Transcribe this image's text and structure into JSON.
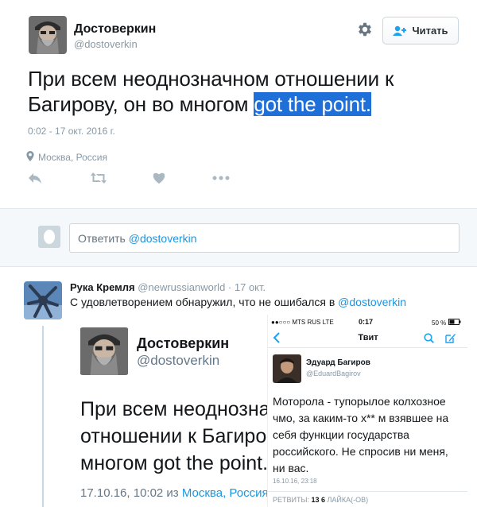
{
  "main_tweet": {
    "author_name": "Достоверкин",
    "author_handle": "@dostoverkin",
    "follow_label": "Читать",
    "text_plain": "При всем неоднозначном отношении к Багирову, он во многом ",
    "text_highlight": "got the point.",
    "time": "0:02 - 17 окт. 2016 г.",
    "location": "Москва, Россия",
    "actions": [
      "reply-icon",
      "retweet-icon",
      "like-icon",
      "more-icon"
    ]
  },
  "reply_box": {
    "prefix": "Ответить ",
    "mention": "@dostoverkin"
  },
  "second_tweet": {
    "author_name": "Рука Кремля",
    "author_handle": "@newrussianworld",
    "separator": " · ",
    "time": "17 окт.",
    "text_plain": "С удовлетворением обнаружил, что не ошибался в ",
    "text_mention": "@dostoverkin"
  },
  "screenshot_web": {
    "author_name": "Достоверкин",
    "author_handle": "@dostoverkin",
    "lines": [
      "При всем неоднозначном",
      "отношении к Багирову, он во",
      "многом got the point."
    ],
    "date_prefix": "17.10.16, 10:02 из ",
    "location": "Москва, Россия"
  },
  "screenshot_phone": {
    "carrier": "●●○○○ MTS RUS  LTE",
    "clock": "0:17",
    "battery": "50 %",
    "nav_title": "Твит",
    "author_name": "Эдуард Багиров",
    "author_handle": "@EduardBagirov",
    "text": "Моторола - тупорылое колхозное чмо, за каким-то х** м взявшее на себя функции государства российского. Не спросив ни меня, ни вас.",
    "date": "16.10.16, 23:18",
    "stats_retweets_label": "РЕТВИТЫ: ",
    "stats_retweets": "13",
    "stats_likes": "6",
    "stats_likes_label": " ЛАЙКА(-ОВ)"
  },
  "colors": {
    "link": "#1b95e0",
    "selection": "#1e6fd8",
    "muted": "#8899a6",
    "reply_bg": "#f5f8fa"
  }
}
